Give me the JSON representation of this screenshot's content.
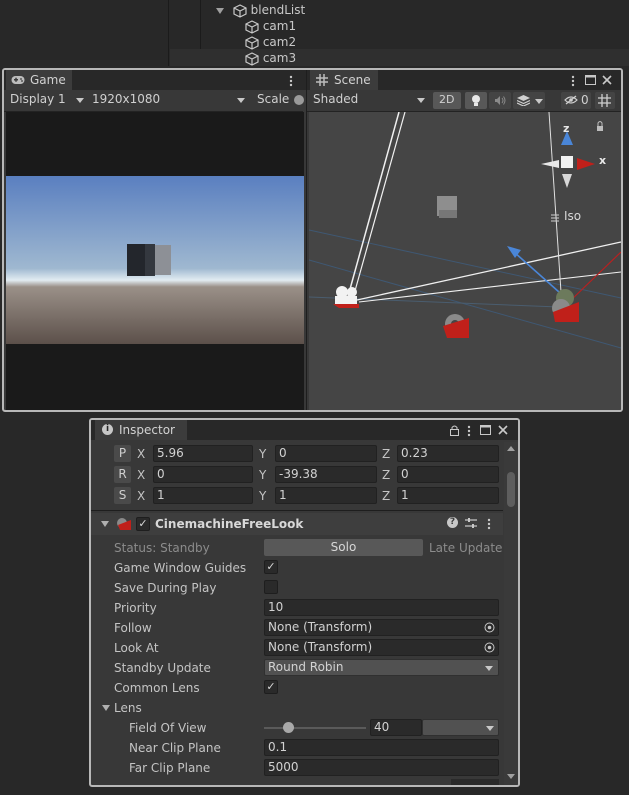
{
  "hierarchy": {
    "items": [
      {
        "label": "blendList"
      },
      {
        "label": "cam1"
      },
      {
        "label": "cam2"
      },
      {
        "label": "cam3"
      }
    ]
  },
  "game": {
    "tab_label": "Game",
    "display": "Display 1",
    "resolution": "1920x1080",
    "scale_label": "Scale"
  },
  "scene": {
    "tab_label": "Scene",
    "shading": "Shaded",
    "mode_2d": "2D",
    "hidden_count": "0",
    "gizmo": {
      "z": "z",
      "x": "x",
      "projection": "Iso"
    }
  },
  "inspector": {
    "tab_label": "Inspector",
    "transform": {
      "position": {
        "btn": "P",
        "x": "5.96",
        "y": "0",
        "z": "0.23"
      },
      "rotation": {
        "btn": "R",
        "x": "0",
        "y": "-39.38",
        "z": "0"
      },
      "scale": {
        "btn": "S",
        "x": "1",
        "y": "1",
        "z": "1"
      },
      "axis_x": "X",
      "axis_y": "Y",
      "axis_z": "Z"
    },
    "component": {
      "title": "CinemachineFreeLook",
      "enabled": true,
      "status_label": "Status: Standby",
      "solo_label": "Solo",
      "late_update_label": "Late Update",
      "game_window_guides_label": "Game Window Guides",
      "game_window_guides": true,
      "save_during_play_label": "Save During Play",
      "save_during_play": false,
      "priority_label": "Priority",
      "priority": "10",
      "follow_label": "Follow",
      "follow": "None (Transform)",
      "look_at_label": "Look At",
      "look_at": "None (Transform)",
      "standby_update_label": "Standby Update",
      "standby_update": "Round Robin",
      "common_lens_label": "Common Lens",
      "common_lens": true,
      "lens_label": "Lens",
      "fov_label": "Field Of View",
      "fov": "40",
      "fov_slider_fraction": 0.25,
      "near_clip_label": "Near Clip Plane",
      "near_clip": "0.1",
      "far_clip_label": "Far Clip Plane",
      "far_clip": "5000"
    }
  },
  "colors": {
    "accent_red": "#c0201a",
    "axis_blue": "#4a86d8",
    "sky_top": "#5a7fc0",
    "ground": "#6e6058"
  }
}
